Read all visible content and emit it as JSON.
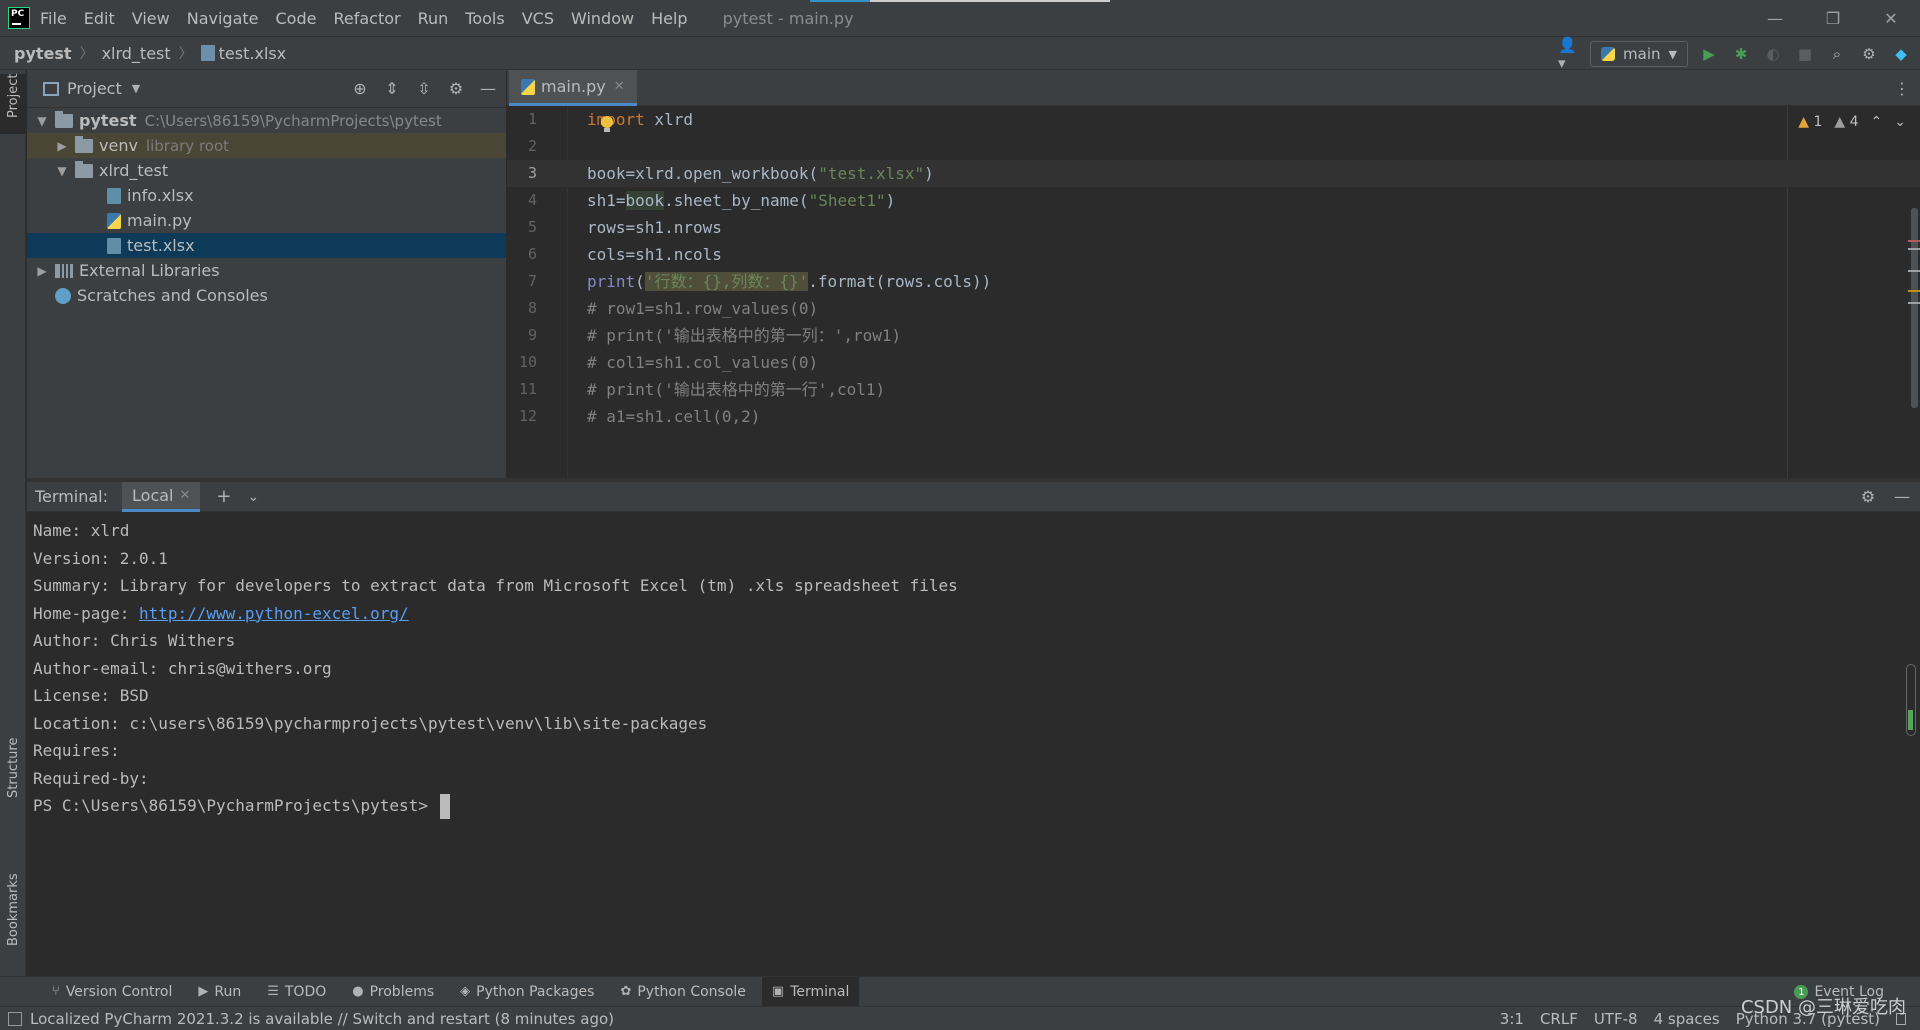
{
  "menubar": {
    "items": [
      "File",
      "Edit",
      "View",
      "Navigate",
      "Code",
      "Refactor",
      "Run",
      "Tools",
      "VCS",
      "Window",
      "Help"
    ],
    "title": "pytest - main.py",
    "minimize": "—",
    "restore": "❐",
    "close": "✕"
  },
  "navbar": {
    "breadcrumbs": [
      "pytest",
      "xlrd_test",
      "test.xlsx"
    ],
    "run_config": "main"
  },
  "left_stripe": {
    "project": "Project",
    "structure": "Structure",
    "bookmarks": "Bookmarks"
  },
  "project": {
    "title": "Project",
    "tree": {
      "root": "pytest",
      "root_path": "C:\\Users\\86159\\PycharmProjects\\pytest",
      "venv": "venv",
      "venv_note": "library root",
      "folder": "xlrd_test",
      "files": [
        "info.xlsx",
        "main.py",
        "test.xlsx"
      ],
      "external": "External Libraries",
      "scratches": "Scratches and Consoles"
    }
  },
  "editor": {
    "tab": "main.py",
    "inspection": {
      "warnings": "1",
      "weak_warnings": "4"
    },
    "line_numbers": [
      "1",
      "2",
      "3",
      "4",
      "5",
      "6",
      "7",
      "8",
      "9",
      "10",
      "11",
      "12"
    ],
    "lines": {
      "l1_kw": "import",
      "l1_rest": " xlrd",
      "l3_a": "book",
      "l3_b": "=xlrd.open_workbook(",
      "l3_str": "\"test.xlsx\"",
      "l3_c": ")",
      "l4_a": "sh1=",
      "l4_b": "book",
      "l4_c": ".sheet_by_name(",
      "l4_str": "\"Sheet1\"",
      "l4_d": ")",
      "l5": "rows=sh1.nrows",
      "l6": "cols=sh1.ncols",
      "l7_fn": "print",
      "l7_open": "(",
      "l7_str": "'行数：{},列数：{}'",
      "l7_rest": ".format(rows.cols))",
      "l8": "# row1=sh1.row_values(0)",
      "l9": "# print('输出表格中的第一列：',row1)",
      "l10": "# col1=sh1.col_values(0)",
      "l11": "# print('输出表格中的第一行',col1)",
      "l12": "# a1=sh1.cell(0,2)"
    }
  },
  "terminal": {
    "label": "Terminal:",
    "tab": "Local",
    "lines": [
      "Name: xlrd",
      "Version: 2.0.1",
      "Summary: Library for developers to extract data from Microsoft Excel (tm) .xls spreadsheet files",
      "Author: Chris Withers",
      "Author-email: chris@withers.org",
      "License: BSD",
      "Location: c:\\users\\86159\\pycharmprojects\\pytest\\venv\\lib\\site-packages",
      "Requires:",
      "Required-by:",
      "PS C:\\Users\\86159\\PycharmProjects\\pytest> "
    ],
    "homepage_label": "Home-page: ",
    "homepage_url": "http://www.python-excel.org/"
  },
  "toolwindows": {
    "items": [
      "Version Control",
      "Run",
      "TODO",
      "Problems",
      "Python Packages",
      "Python Console",
      "Terminal"
    ],
    "event_log": "Event Log",
    "event_count": "1"
  },
  "status": {
    "message": "Localized PyCharm 2021.3.2 is available // Switch and restart (8 minutes ago)",
    "position": "3:1",
    "line_sep": "CRLF",
    "encoding": "UTF-8",
    "indent": "4 spaces",
    "interpreter": "Python 3.7 (pytest)",
    "watermark": "CSDN @三琳爱吃肉"
  }
}
